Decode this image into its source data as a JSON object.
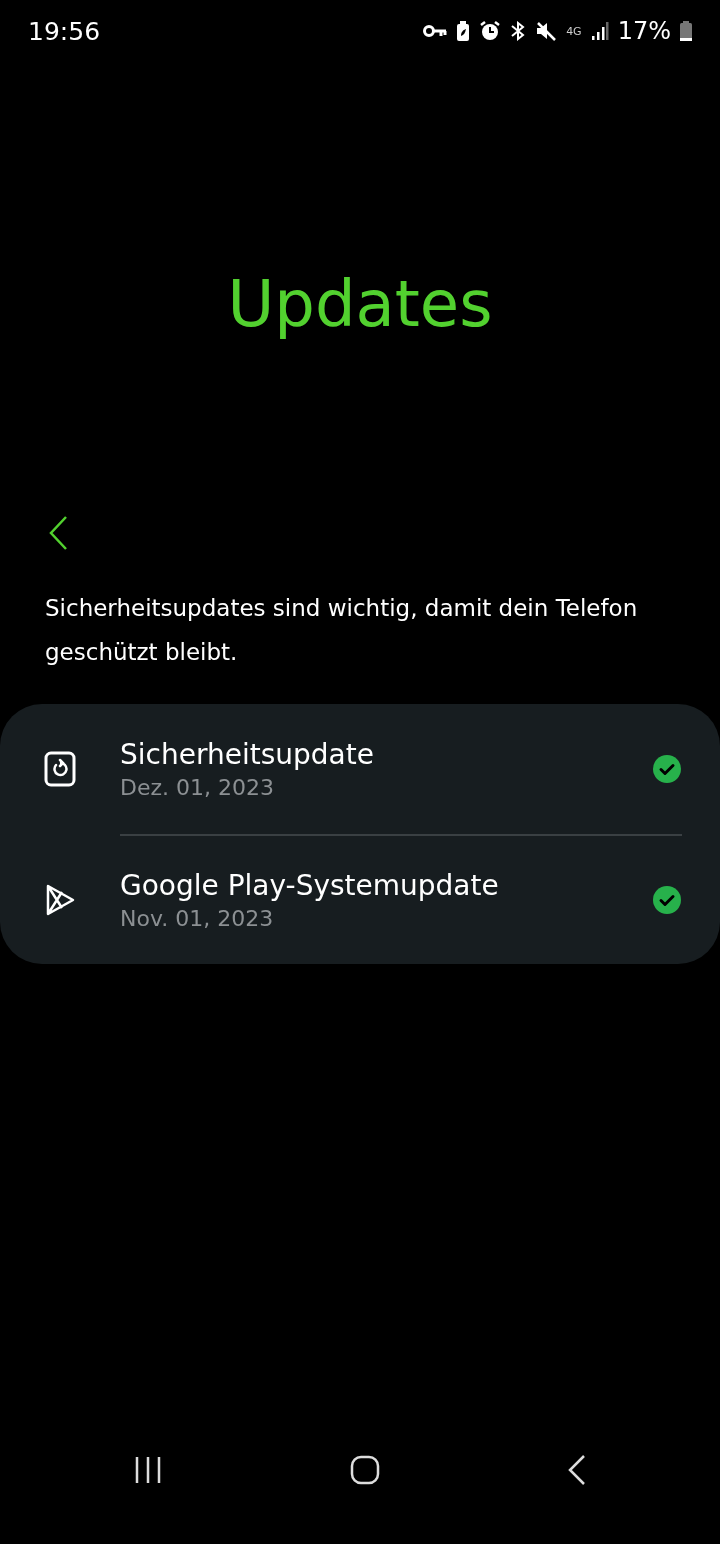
{
  "status_bar": {
    "time": "19:56",
    "network": "4G",
    "battery": "17%"
  },
  "title": "Updates",
  "description": "Sicherheitsupdates sind wichtig, damit dein Telefon geschützt bleibt.",
  "items": [
    {
      "kind": "security",
      "title": "Sicherheitsupdate",
      "date": "Dez. 01, 2023",
      "up_to_date": true
    },
    {
      "kind": "play",
      "title": "Google Play-Systemupdate",
      "date": "Nov. 01, 2023",
      "up_to_date": true
    }
  ]
}
